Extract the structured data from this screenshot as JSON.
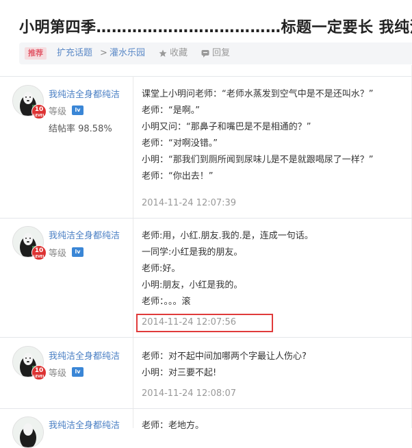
{
  "thread": {
    "title": "小明第四季………………………………标题一定要长 我纯洁",
    "badge": "推荐",
    "breadcrumb": [
      "扩充话题",
      ">",
      "灌水乐园"
    ],
    "actions": {
      "favorite": "收藏",
      "reply": "回复"
    }
  },
  "posts": [
    {
      "user": {
        "name": "我纯洁全身都纯洁",
        "level": "10",
        "grade_label": "等级",
        "grade_badge": "lv",
        "rate": "结帖率 98.58%"
      },
      "lines": [
        "课堂上小明问老师：“老师水蒸发到空气中是不是还叫水？”",
        "老师：“是啊。”",
        "小明又问：“那鼻子和嘴巴是不是相通的？”",
        "老师：“对啊没错。”",
        "小明：“那我们到厕所闻到尿味儿是不是就跟喝尿了一样？”",
        "老师：“你出去！”"
      ],
      "time": "2014-11-24 12:07:39"
    },
    {
      "user": {
        "name": "我纯洁全身都纯洁",
        "level": "10",
        "grade_label": "等级",
        "grade_badge": "lv"
      },
      "lines": [
        "老师:用，小红.朋友.我的.是，连成一句话。",
        "一同学:小红是我的朋友。",
        "老师:好。",
        "小明:朋友，小红是我的。",
        "老师：。。。滚"
      ],
      "time": "2014-11-24 12:07:56"
    },
    {
      "user": {
        "name": "我纯洁全身都纯洁",
        "level": "10",
        "grade_label": "等级",
        "grade_badge": "lv"
      },
      "lines": [
        "老师：对不起中间加哪两个字最让人伤心?",
        "小明：对三要不起!"
      ],
      "time": "2014-11-24 12:08:07"
    },
    {
      "user": {
        "name": "我纯洁全身都纯洁"
      },
      "lines": [
        "老师：老地方。"
      ]
    }
  ],
  "colors": {
    "link": "#4a7fc4",
    "highlight_box": "#e03a3a",
    "badge_bg": "#f5dde0",
    "badge_fg": "#e25a6a"
  }
}
